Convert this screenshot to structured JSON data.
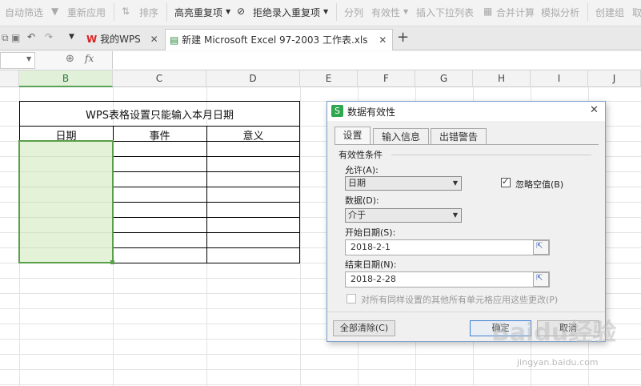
{
  "ribbon": {
    "auto_filter": "自动筛选",
    "reapply": "重新应用",
    "sort": "排序",
    "highlight_dup": "高亮重复项",
    "reject_dup": "拒绝录入重复项",
    "split": "分列",
    "validity": "有效性",
    "insert_dropdown": "插入下拉列表",
    "merge_calc": "合并计算",
    "simulate": "模拟分析",
    "create_group": "创建组",
    "cancel_group": "取"
  },
  "tabs": {
    "wps_tab": "我的WPS",
    "file_tab": "新建 Microsoft Excel 97-2003 工作表.xls"
  },
  "formula": {
    "fx": "fx"
  },
  "columns": [
    "B",
    "C",
    "D",
    "E",
    "F",
    "G",
    "H",
    "I",
    "J"
  ],
  "table": {
    "title": "WPS表格设置只能输入本月日期",
    "headers": [
      "日期",
      "事件",
      "意义"
    ]
  },
  "dialog": {
    "title": "数据有效性",
    "tabs": [
      "设置",
      "输入信息",
      "出错警告"
    ],
    "section": "有效性条件",
    "allow_label": "允许(A):",
    "allow_value": "日期",
    "ignore_blank": "忽略空值(B)",
    "data_label": "数据(D):",
    "data_value": "介于",
    "start_label": "开始日期(S):",
    "start_value": "2018-2-1",
    "end_label": "结束日期(N):",
    "end_value": "2018-2-28",
    "apply_all": "对所有同样设置的其他所有单元格应用这些更改(P)",
    "clear_all": "全部清除(C)",
    "ok": "确定",
    "cancel": "取消"
  },
  "watermark": {
    "brand": "Baidu经验",
    "site": "jingyan.baidu.com"
  }
}
